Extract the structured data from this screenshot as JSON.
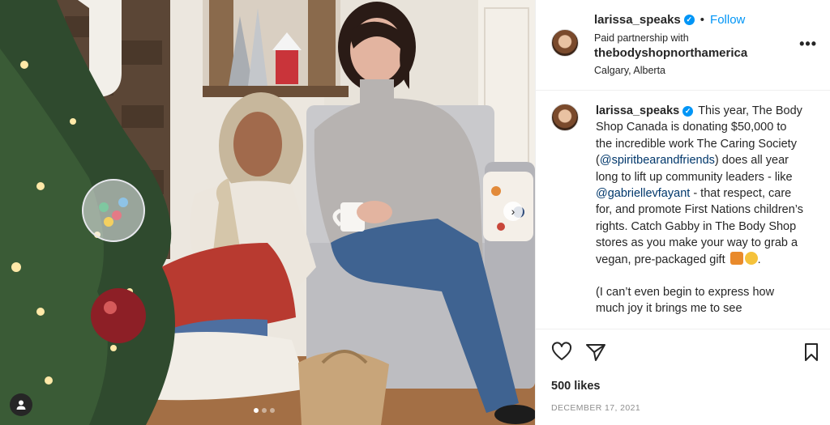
{
  "post": {
    "dots_count": 3,
    "active_dot": 0
  },
  "header": {
    "username": "larissa_speaks",
    "separator": "•",
    "follow_label": "Follow",
    "paid_partnership_label": "Paid partnership with",
    "partner": "thebodyshopnorthamerica",
    "location": "Calgary, Alberta",
    "more_label": "•••"
  },
  "caption": {
    "username": "larissa_speaks",
    "text_1": "This year, The Body Shop Canada is donating $50,000 to the incredible work The Caring Society (",
    "mention_1": "@spiritbearandfriends",
    "text_2": ") does all year long to lift up community leaders - like ",
    "mention_2": "@gabriellevfayant",
    "text_3": " - that respect, care for, and promote First Nations children’s rights. Catch Gabby in The Body Shop stores as you make your way to grab a vegan, pre-packaged gift ",
    "text_4": ".",
    "para_2": "(I can’t even begin to express how much joy it brings me to see"
  },
  "stats": {
    "likes": "500 likes",
    "date": "DECEMBER 17, 2021"
  },
  "icons": {
    "verified": "✓",
    "next": "›"
  }
}
